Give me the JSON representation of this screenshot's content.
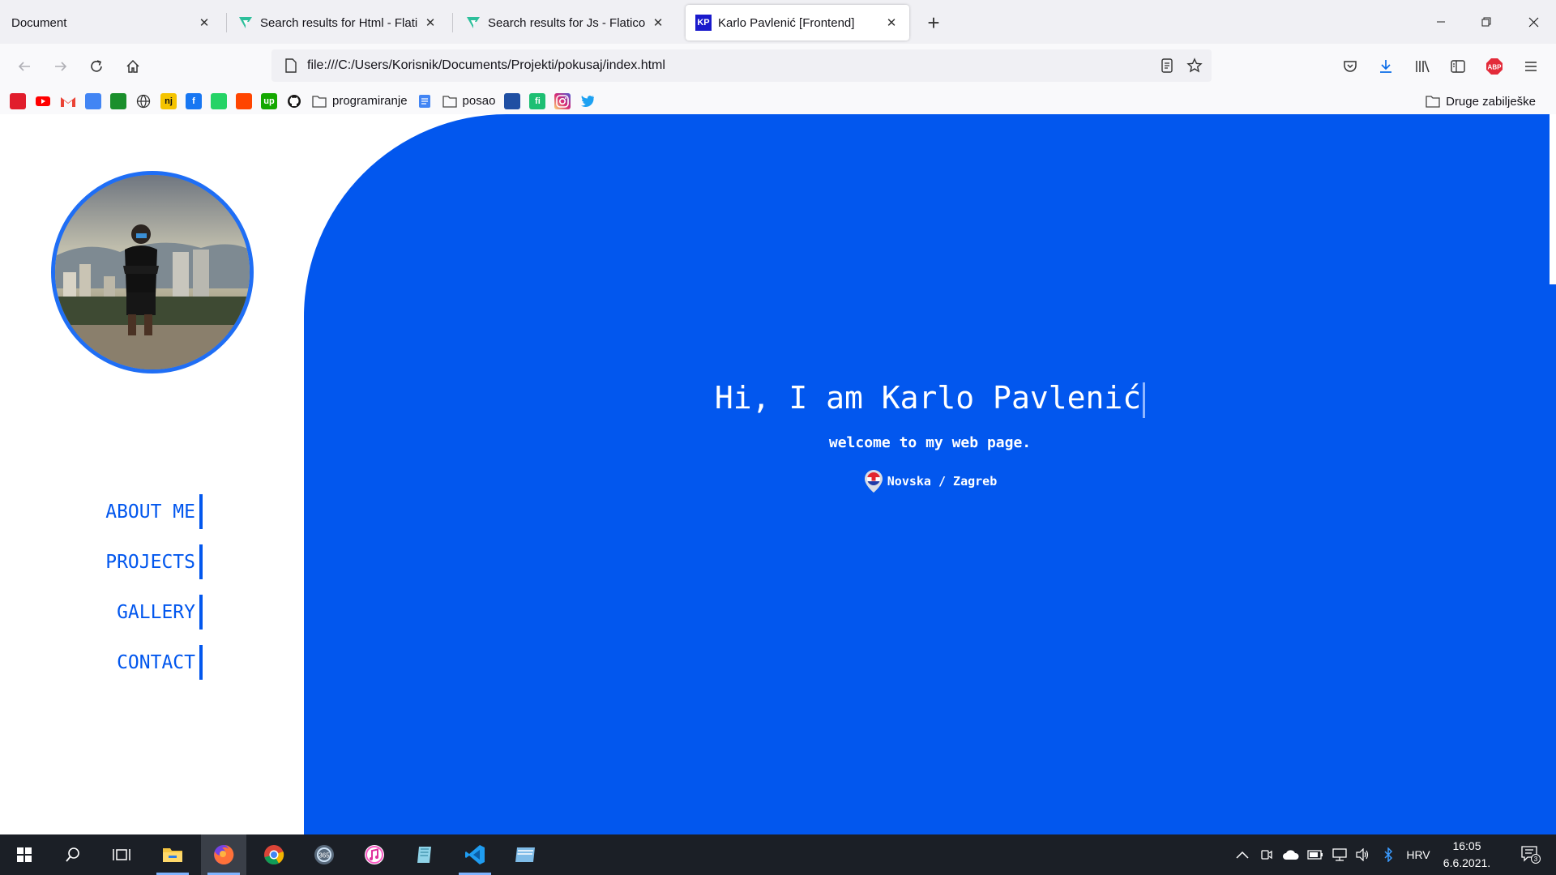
{
  "browser": {
    "tabs": [
      {
        "title": "Document",
        "favicon": "none",
        "active": false
      },
      {
        "title": "Search results for Html - Flatico",
        "favicon": "flaticon-icon",
        "active": false
      },
      {
        "title": "Search results for Js - Flaticon",
        "favicon": "flaticon-icon",
        "active": false
      },
      {
        "title": "Karlo Pavlenić [Frontend]",
        "favicon": "kp-icon",
        "favicon_text": "KP",
        "active": true
      }
    ],
    "url": "file:///C:/Users/Korisnik/Documents/Projekti/pokusaj/index.html",
    "bookmarks": [
      {
        "label": "",
        "icon": "app-icon-red",
        "color": "#e11d2c"
      },
      {
        "label": "",
        "icon": "youtube-icon",
        "color": "#ff0000"
      },
      {
        "label": "",
        "icon": "gmail-icon",
        "color": "#ea4335"
      },
      {
        "label": "",
        "icon": "translate-icon",
        "color": "#4285f4"
      },
      {
        "label": "",
        "icon": "app-icon-green",
        "color": "#1a8f2c"
      },
      {
        "label": "",
        "icon": "globe-icon",
        "color": "#555555"
      },
      {
        "label": "",
        "icon": "nj-icon",
        "color": "#f5c400",
        "text": "nj"
      },
      {
        "label": "",
        "icon": "facebook-icon",
        "color": "#1877f2",
        "text": "f"
      },
      {
        "label": "",
        "icon": "whatsapp-icon",
        "color": "#25d366"
      },
      {
        "label": "",
        "icon": "reddit-icon",
        "color": "#ff4500"
      },
      {
        "label": "",
        "icon": "upwork-icon",
        "color": "#14a800",
        "text": "up"
      },
      {
        "label": "",
        "icon": "github-icon",
        "color": "#181717"
      },
      {
        "label": "programiranje",
        "icon": "folder-icon",
        "color": "#555555"
      },
      {
        "label": "",
        "icon": "docs-icon",
        "color": "#4285f4"
      },
      {
        "label": "posao",
        "icon": "folder-icon",
        "color": "#555555"
      },
      {
        "label": "",
        "icon": "app-icon-blue",
        "color": "#1f4fa3"
      },
      {
        "label": "",
        "icon": "fiverr-icon",
        "color": "#1dbf73",
        "text": "fi"
      },
      {
        "label": "",
        "icon": "instagram-icon",
        "color": "#d62976"
      },
      {
        "label": "",
        "icon": "twitter-icon",
        "color": "#1da1f2"
      }
    ],
    "other_bookmarks": "Druge zabilješke"
  },
  "page": {
    "menu": [
      "ABOUT ME",
      "PROJECTS",
      "GALLERY",
      "CONTACT"
    ],
    "hero_title": "Hi, I am Karlo Pavlenić",
    "hero_subtitle": "welcome to my web page.",
    "location": "Novska / Zagreb",
    "colors": {
      "accent": "#0257ee",
      "avatar_ring": "#1f6ef5",
      "text_light": "#ffffff"
    }
  },
  "taskbar": {
    "language": "HRV",
    "time": "16:05",
    "date": "6.6.2021.",
    "notifications": "3"
  }
}
